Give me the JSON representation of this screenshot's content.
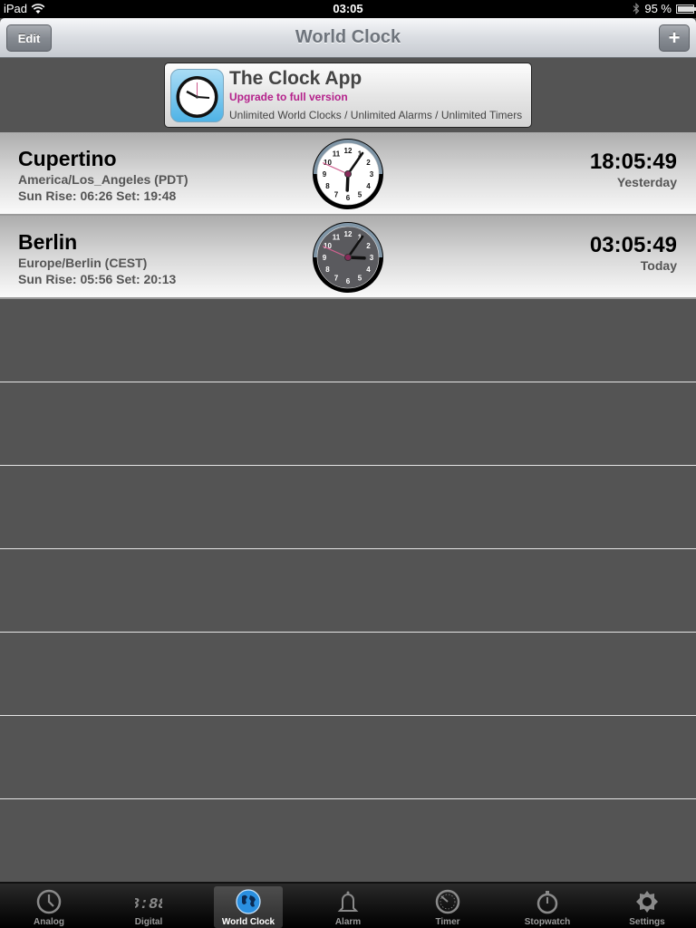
{
  "status_bar": {
    "device": "iPad",
    "time": "03:05",
    "battery_percent_label": "95 %",
    "battery_level": 0.95
  },
  "nav": {
    "title": "World Clock",
    "edit_label": "Edit",
    "add_label": "+"
  },
  "banner": {
    "title": "The Clock App",
    "upgrade": "Upgrade to full version",
    "features": "Unlimited World Clocks / Unlimited Alarms / Unlimited Timers"
  },
  "clocks": [
    {
      "city": "Cupertino",
      "timezone": "America/Los_Angeles (PDT)",
      "sun": "Sun Rise: 06:26 Set: 19:48",
      "time": "18:05:49",
      "day": "Yesterday",
      "hour": 18,
      "minute": 5,
      "second": 49,
      "face": "light"
    },
    {
      "city": "Berlin",
      "timezone": "Europe/Berlin (CEST)",
      "sun": "Sun Rise: 05:56 Set: 20:13",
      "time": "03:05:49",
      "day": "Today",
      "hour": 3,
      "minute": 5,
      "second": 49,
      "face": "dark"
    }
  ],
  "empty_rows": 7,
  "tabs": [
    {
      "label": "Analog",
      "icon": "analog-clock-icon",
      "active": false
    },
    {
      "label": "Digital",
      "icon": "digital-clock-icon",
      "active": false
    },
    {
      "label": "World Clock",
      "icon": "globe-icon",
      "active": true
    },
    {
      "label": "Alarm",
      "icon": "bell-icon",
      "active": false
    },
    {
      "label": "Timer",
      "icon": "timer-icon",
      "active": false
    },
    {
      "label": "Stopwatch",
      "icon": "stopwatch-icon",
      "active": false
    },
    {
      "label": "Settings",
      "icon": "gear-icon",
      "active": false
    }
  ],
  "colors": {
    "upgrade_text": "#b5228c",
    "second_hand": "#d0608f"
  }
}
